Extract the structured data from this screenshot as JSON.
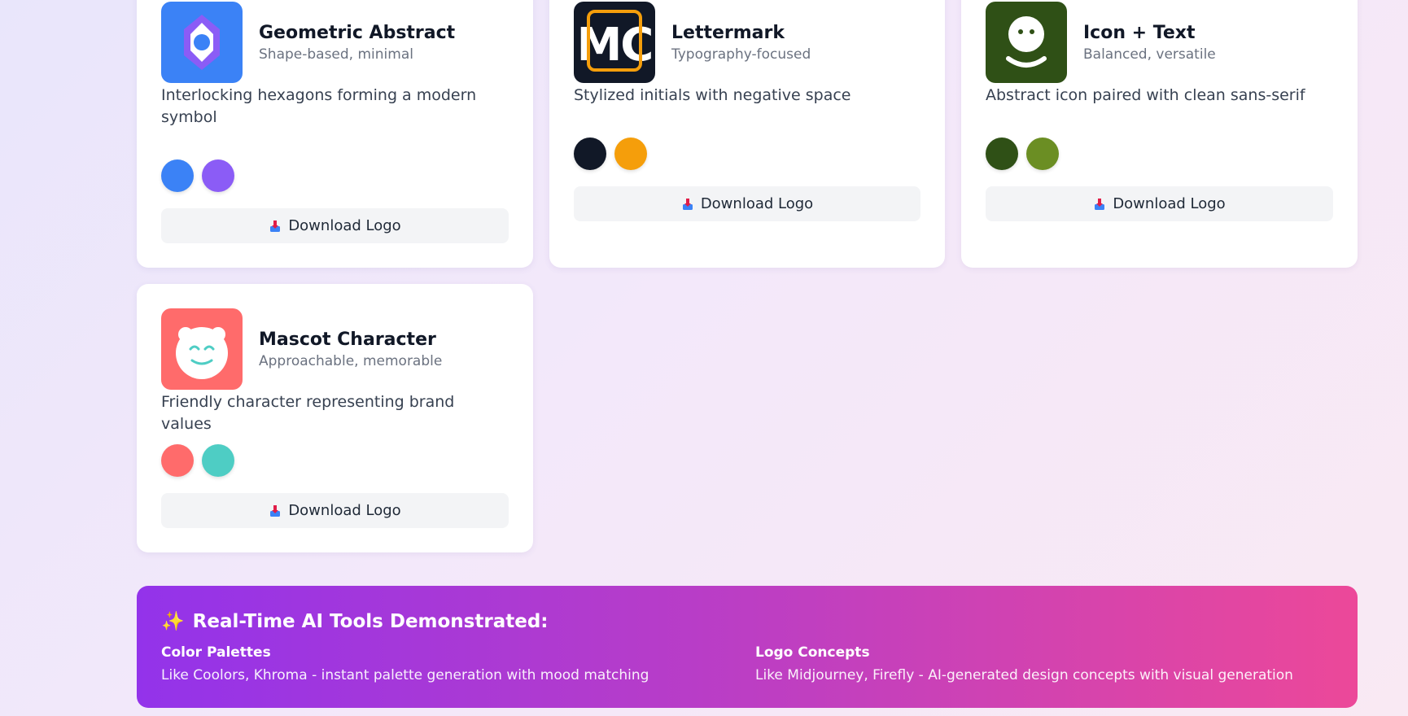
{
  "cards": [
    {
      "title": "Geometric Abstract",
      "subtitle": "Shape-based, minimal",
      "description": "Interlocking hexagons forming a modern symbol",
      "colors": [
        "#3b82f6",
        "#8b5cf6"
      ],
      "button_label": "Download Logo"
    },
    {
      "title": "Lettermark",
      "subtitle": "Typography-focused",
      "description": "Stylized initials with negative space",
      "colors": [
        "#111827",
        "#f59e0b"
      ],
      "logo_text": "MC",
      "button_label": "Download Logo"
    },
    {
      "title": "Icon + Text",
      "subtitle": "Balanced, versatile",
      "description": "Abstract icon paired with clean sans-serif",
      "colors": [
        "#2f5016",
        "#6b8e23"
      ],
      "button_label": "Download Logo"
    },
    {
      "title": "Mascot Character",
      "subtitle": "Approachable, memorable",
      "description": "Friendly character representing brand values",
      "colors": [
        "#ff6b6b",
        "#4ecdc4"
      ],
      "button_label": "Download Logo"
    }
  ],
  "banner": {
    "icon": "sparkles-icon",
    "title_icon": "✨",
    "title": "Real-Time AI Tools Demonstrated:",
    "columns": [
      {
        "title": "Color Palettes",
        "text": "Like Coolors, Khroma - instant palette generation with mood matching"
      },
      {
        "title": "Logo Concepts",
        "text": "Like Midjourney, Firefly - AI-generated design concepts with visual generation"
      }
    ]
  }
}
